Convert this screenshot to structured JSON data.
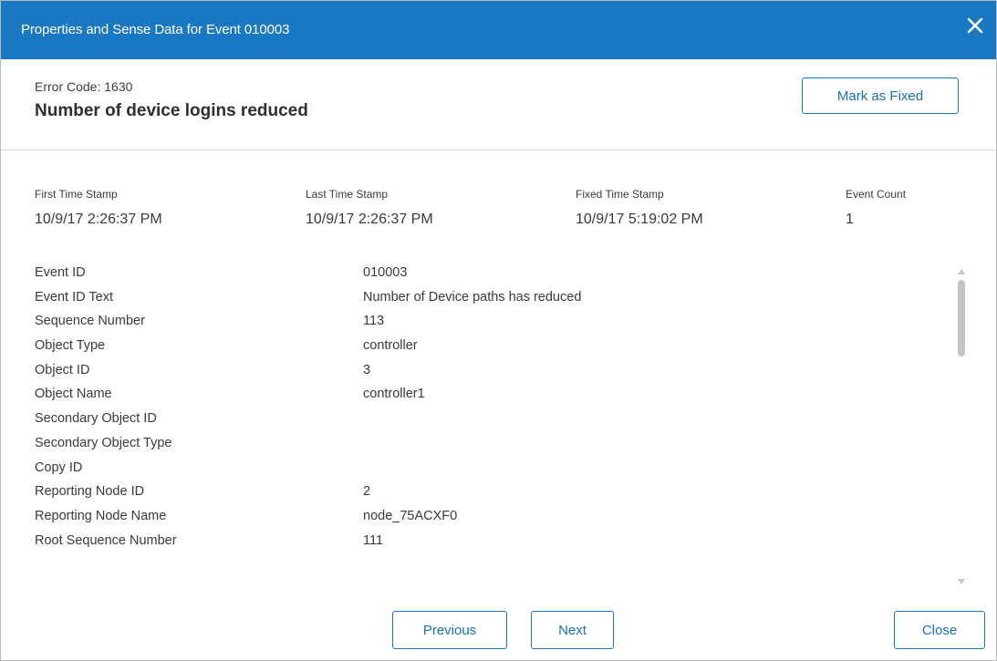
{
  "dialog": {
    "title": "Properties and Sense Data for Event 010003",
    "close_icon": "close-icon"
  },
  "header": {
    "error_code": "Error Code: 1630",
    "error_title": "Number of device logins reduced",
    "mark_fixed_label": "Mark as Fixed"
  },
  "stamps": {
    "first": {
      "label": "First Time Stamp",
      "value": "10/9/17 2:26:37 PM"
    },
    "last": {
      "label": "Last Time Stamp",
      "value": "10/9/17 2:26:37 PM"
    },
    "fixed": {
      "label": "Fixed Time Stamp",
      "value": "10/9/17 5:19:02 PM"
    },
    "count": {
      "label": "Event Count",
      "value": "1"
    }
  },
  "properties": [
    {
      "key": "Event ID",
      "value": "010003"
    },
    {
      "key": "Event ID Text",
      "value": "Number of Device paths has reduced"
    },
    {
      "key": "Sequence Number",
      "value": "113"
    },
    {
      "key": "Object Type",
      "value": "controller"
    },
    {
      "key": "Object ID",
      "value": "3"
    },
    {
      "key": "Object Name",
      "value": "controller1"
    },
    {
      "key": "Secondary Object ID",
      "value": ""
    },
    {
      "key": "Secondary Object Type",
      "value": ""
    },
    {
      "key": "Copy ID",
      "value": ""
    },
    {
      "key": "Reporting Node ID",
      "value": "2"
    },
    {
      "key": "Reporting Node Name",
      "value": "node_75ACXF0"
    },
    {
      "key": "Root Sequence Number",
      "value": "111"
    }
  ],
  "footer": {
    "previous_label": "Previous",
    "next_label": "Next",
    "close_label": "Close"
  },
  "colors": {
    "titlebar": "#1a78c2",
    "button_border": "#1a78c2",
    "button_text": "#1a6fb5"
  }
}
